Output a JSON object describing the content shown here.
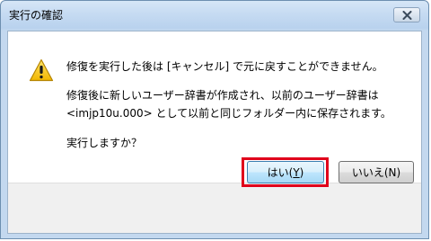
{
  "dialog": {
    "title": "実行の確認",
    "close_icon": "close-x-icon",
    "warning_icon": "warning-triangle-icon",
    "message_line1": "修復を実行した後は [キャンセル] で元に戻すことができません。",
    "message_line2": "修復後に新しいユーザー辞書が作成され、以前のユーザー辞書は",
    "message_line3": "<imjp10u.000> として以前と同じフォルダー内に保存されます。",
    "message_line4": "実行しますか？",
    "yes_button": {
      "label_prefix": "はい(",
      "accel": "Y",
      "label_suffix": ")"
    },
    "no_button": {
      "label": "いいえ(N)"
    },
    "highlight_color": "#e0001b"
  }
}
